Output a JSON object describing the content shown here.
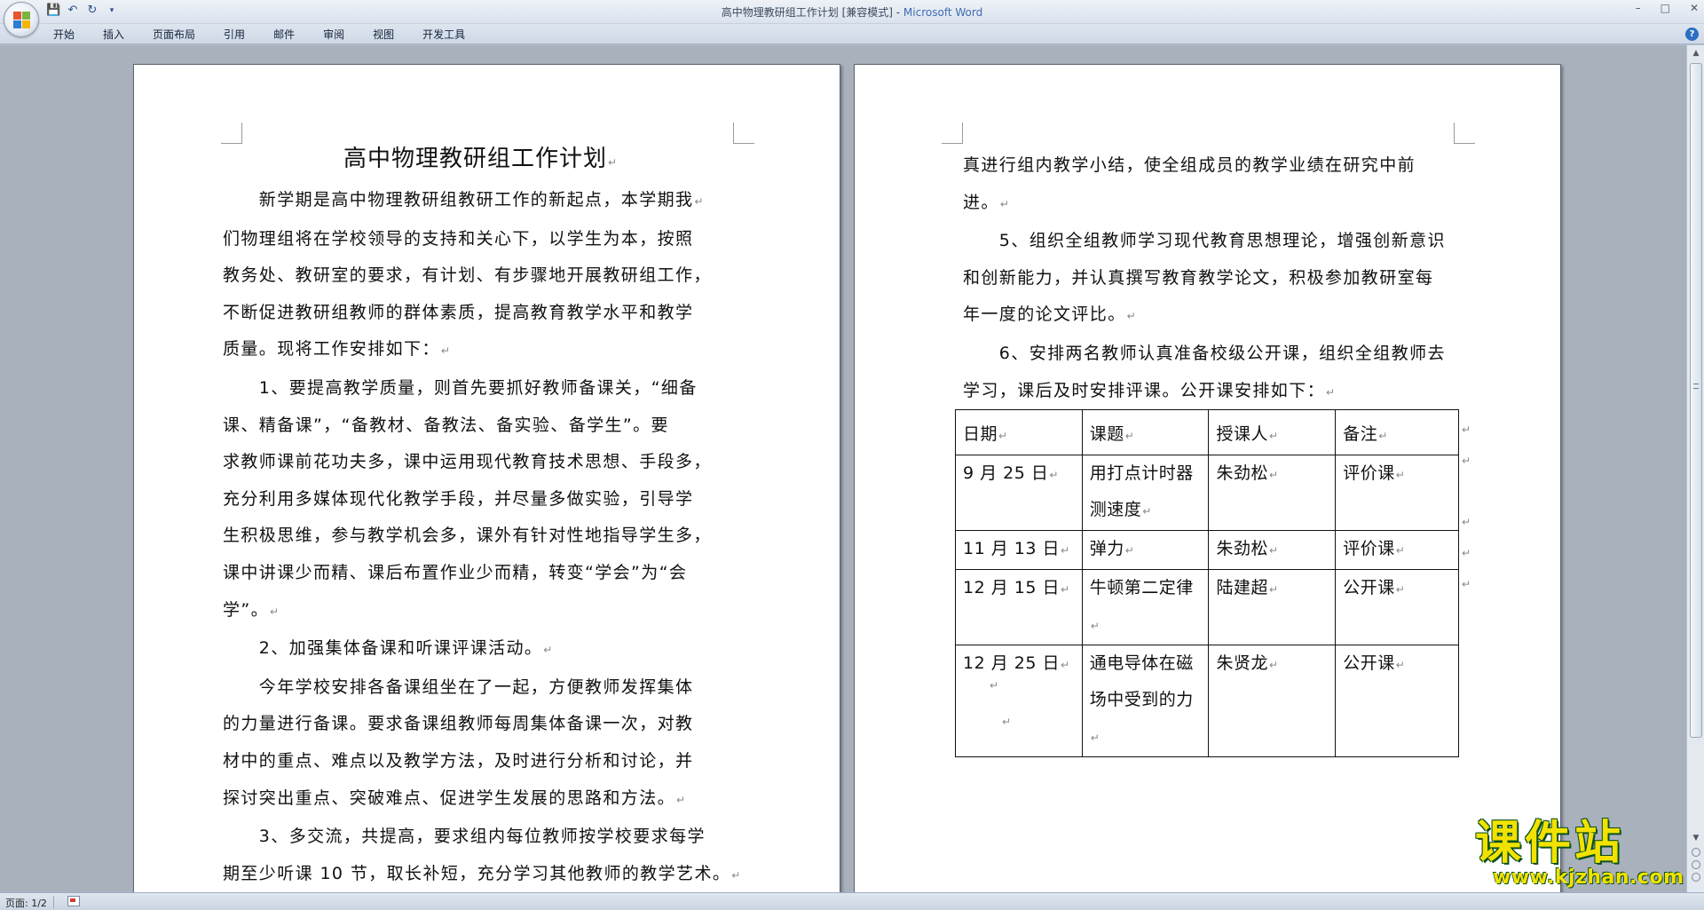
{
  "window": {
    "title_doc": "高中物理教研组工作计划 [兼容模式] - ",
    "title_app": "Microsoft Word",
    "controls": [
      "–",
      "□",
      "✕"
    ]
  },
  "ribbon": {
    "tabs": [
      "开始",
      "插入",
      "页面布局",
      "引用",
      "邮件",
      "审阅",
      "视图",
      "开发工具"
    ],
    "help": "?"
  },
  "page1": {
    "title": "高中物理教研组工作计划",
    "lines": [
      "　　新学期是高中物理教研组教研工作的新起点，本学期我",
      "们物理组将在学校领导的支持和关心下，以学生为本，按照",
      "教务处、教研室的要求，有计划、有步骤地开展教研组工作，",
      "不断促进教研组教师的群体素质，提高教育教学水平和教学",
      "质量。现将工作安排如下：",
      "　　1、要提高教学质量，则首先要抓好教师备课关，“细备",
      "课、精备课”，“备教材、备教法、备实验、备学生”。要",
      "求教师课前花功夫多，课中运用现代教育技术思想、手段多，",
      "充分利用多媒体现代化教学手段，并尽量多做实验，引导学",
      "生积极思维，参与教学机会多，课外有针对性地指导学生多，",
      "课中讲课少而精、课后布置作业少而精，转变“学会”为“会",
      "学”。",
      "　　2、加强集体备课和听课评课活动。",
      "　　今年学校安排各备课组坐在了一起，方便教师发挥集体",
      "的力量进行备课。要求备课组教师每周集体备课一次，对教",
      "材中的重点、难点以及教学方法，及时进行分析和讨论，并",
      "探讨突出重点、突破难点、促进学生发展的思路和方法。",
      "　　3、多交流，共提高，要求组内每位教师按学校要求每学",
      "期至少听课 10 节，取长补短，充分学习其他教师的教学艺术。"
    ],
    "para_end_lines": [
      0,
      4,
      11,
      12,
      16,
      18
    ]
  },
  "page2": {
    "lines": [
      "真进行组内教学小结，使全组成员的教学业绩在研究中前",
      "进。",
      "　　5、组织全组教师学习现代教育思想理论，增强创新意识",
      "和创新能力，并认真撰写教育教学论文，积极参加教研室每",
      "年一度的论文评比。",
      "　　6、安排两名教师认真准备校级公开课，组织全组教师去",
      "学习，课后及时安排评课。公开课安排如下："
    ],
    "para_end_lines": [
      1,
      4,
      6
    ],
    "table": {
      "headers": [
        "日期",
        "课题",
        "授课人",
        "备注"
      ],
      "rows": [
        [
          "9 月 25 日",
          "用打点计时器测速度",
          "朱劲松",
          "评价课"
        ],
        [
          "11 月 13 日",
          "弹力",
          "朱劲松",
          "评价课"
        ],
        [
          "12 月 15 日",
          "牛顿第二定律",
          "陆建超",
          "公开课"
        ],
        [
          "12 月 25 日",
          "通电导体在磁场中受到的力",
          "朱贤龙",
          "公开课"
        ]
      ]
    }
  },
  "statusbar": {
    "page_info": "页面: 1/2"
  },
  "watermark": {
    "big": "课件站",
    "url": "www.kjzhan.com"
  },
  "marks": {
    "paragraph": "↵"
  }
}
